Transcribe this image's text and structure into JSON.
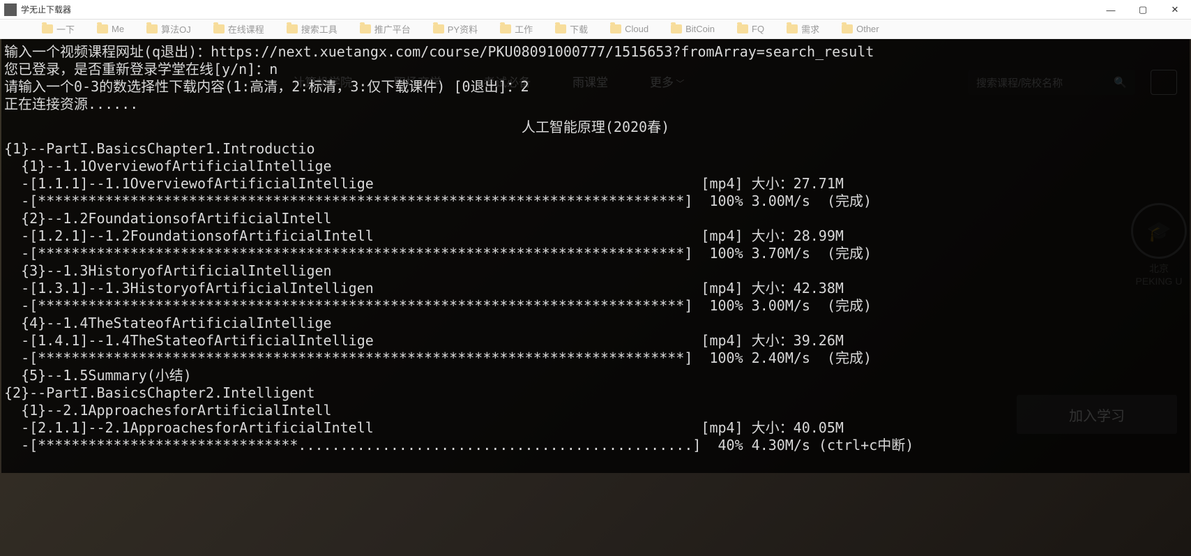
{
  "window": {
    "title": "学无止下载器"
  },
  "bookmarks": [
    "一下",
    "Me",
    "算法OJ",
    "在线课程",
    "搜索工具",
    "推广平台",
    "PY资料",
    "工作",
    "下载",
    "Cloud",
    "BitCoin",
    "FQ",
    "需求",
    "Other"
  ],
  "bg_nav": [
    "计算机学院",
    "职场商学",
    "考试必备",
    "雨课堂",
    "更多"
  ],
  "bg_search_placeholder": "搜索课程/院校名称",
  "bg_join_label": "加入学习",
  "bg_pku": {
    "cn": "北京",
    "en": "PEKING U"
  },
  "prompt": {
    "l1": "输入一个视频课程网址(q退出)：https://next.xuetangx.com/course/PKU08091000777/1515653?fromArray=search_result",
    "l2": "您已登录，是否重新登录学堂在线[y/n]：n",
    "l3": "请输入一个0-3的数选择性下载内容(1:高清，2:标清，3:仅下载课件) [0退出]：2",
    "l4": "正在连接资源......"
  },
  "course_title": "人工智能原理(2020春)",
  "tree": [
    "{1}--PartI.BasicsChapter1.Introductio",
    "  {1}--1.1OverviewofArtificialIntellige",
    "  -[1.1.1]--1.1OverviewofArtificialIntellige                                       [mp4] 大小：27.71M",
    "  -[*****************************************************************************]  100% 3.00M/s  (完成)",
    "  {2}--1.2FoundationsofArtificialIntell",
    "  -[1.2.1]--1.2FoundationsofArtificialIntell                                       [mp4] 大小：28.99M",
    "  -[*****************************************************************************]  100% 3.70M/s  (完成)",
    "  {3}--1.3HistoryofArtificialIntelligen",
    "  -[1.3.1]--1.3HistoryofArtificialIntelligen                                       [mp4] 大小：42.38M",
    "  -[*****************************************************************************]  100% 3.00M/s  (完成)",
    "  {4}--1.4TheStateofArtificialIntellige",
    "  -[1.4.1]--1.4TheStateofArtificialIntellige                                       [mp4] 大小：39.26M",
    "  -[*****************************************************************************]  100% 2.40M/s  (完成)",
    "  {5}--1.5Summary(小结)",
    "{2}--PartI.BasicsChapter2.Intelligent",
    "  {1}--2.1ApproachesforArtificialIntell",
    "  -[2.1.1]--2.1ApproachesforArtificialIntell                                       [mp4] 大小：40.05M",
    "  -[*******************************...............................................]  40% 4.30M/s (ctrl+c中断)"
  ],
  "downloads": [
    {
      "id": "1.1.1",
      "title": "1.1OverviewofArtificialIntellige",
      "fmt": "mp4",
      "size": "27.71M",
      "pct": 100,
      "speed": "3.00M/s",
      "status": "完成"
    },
    {
      "id": "1.2.1",
      "title": "1.2FoundationsofArtificialIntell",
      "fmt": "mp4",
      "size": "28.99M",
      "pct": 100,
      "speed": "3.70M/s",
      "status": "完成"
    },
    {
      "id": "1.3.1",
      "title": "1.3HistoryofArtificialIntelligen",
      "fmt": "mp4",
      "size": "42.38M",
      "pct": 100,
      "speed": "3.00M/s",
      "status": "完成"
    },
    {
      "id": "1.4.1",
      "title": "1.4TheStateofArtificialIntellige",
      "fmt": "mp4",
      "size": "39.26M",
      "pct": 100,
      "speed": "2.40M/s",
      "status": "完成"
    },
    {
      "id": "2.1.1",
      "title": "2.1ApproachesforArtificialIntell",
      "fmt": "mp4",
      "size": "40.05M",
      "pct": 40,
      "speed": "4.30M/s",
      "status": "ctrl+c中断"
    }
  ]
}
